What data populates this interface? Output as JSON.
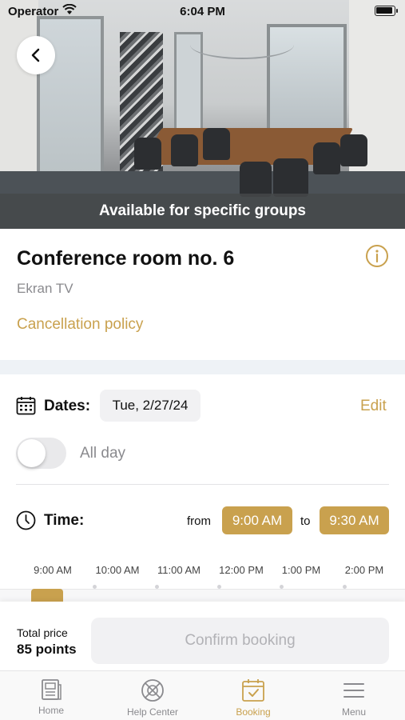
{
  "status_bar": {
    "carrier": "Operator",
    "time": "6:04 PM"
  },
  "hero": {
    "banner": "Available for specific groups"
  },
  "room": {
    "title": "Conference room no. 6",
    "subtitle": "Ekran TV",
    "cancellation_link": "Cancellation policy"
  },
  "dates": {
    "label": "Dates:",
    "value": "Tue, 2/27/24",
    "edit": "Edit"
  },
  "all_day": {
    "label": "All day",
    "enabled": false
  },
  "time": {
    "label": "Time:",
    "from_label": "from",
    "from_value": "9:00 AM",
    "to_label": "to",
    "to_value": "9:30 AM"
  },
  "timeline": {
    "labels": [
      "9:00 AM",
      "10:00 AM",
      "11:00 AM",
      "12:00 PM",
      "1:00 PM",
      "2:00 PM"
    ]
  },
  "footer": {
    "total_label": "Total price",
    "total_value": "85 points",
    "confirm_label": "Confirm booking"
  },
  "tabs": [
    {
      "label": "Home",
      "icon": "home-icon",
      "active": false
    },
    {
      "label": "Help Center",
      "icon": "help-center-icon",
      "active": false
    },
    {
      "label": "Booking",
      "icon": "booking-calendar-icon",
      "active": true
    },
    {
      "label": "Menu",
      "icon": "menu-icon",
      "active": false
    }
  ],
  "colors": {
    "accent": "#c9a14e",
    "muted": "#8a8a8e",
    "chip_bg": "#f1f1f3"
  }
}
